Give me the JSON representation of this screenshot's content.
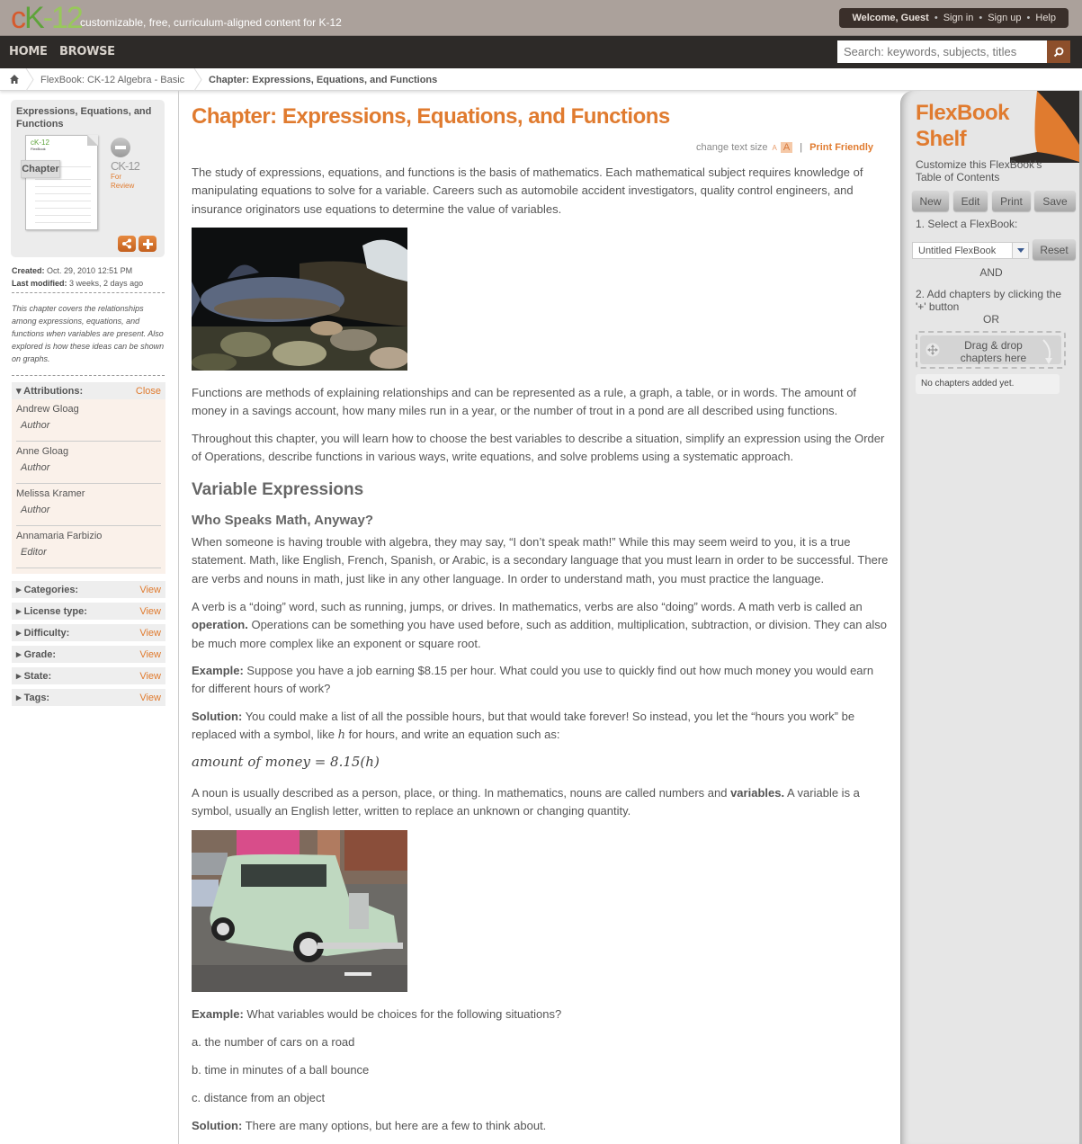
{
  "header": {
    "logo": {
      "c": "c",
      "k": "K",
      "num": "-12"
    },
    "tagline": "customizable, free, curriculum-aligned content for K-12",
    "welcome": "Welcome, Guest",
    "sign_in": "Sign in",
    "sign_up": "Sign up",
    "help": "Help",
    "separator": "•"
  },
  "nav": {
    "items": [
      {
        "label": "HOME"
      },
      {
        "label": "BROWSE"
      }
    ],
    "search_placeholder": "Search: keywords, subjects, titles"
  },
  "breadcrumb": {
    "items": [
      {
        "label": "FlexBook: CK-12 Algebra - Basic"
      },
      {
        "label": "Chapter: Expressions, Equations, and Functions"
      }
    ]
  },
  "sidebar": {
    "card": {
      "title": "Expressions, Equations, and Functions",
      "doc_logo": "cK-12",
      "doc_logo_sub": "FlexBook",
      "doc_tab": "Chapter",
      "publisher": "CK-12",
      "status_line1": "For",
      "status_line2": "Review"
    },
    "created_label": "Created:",
    "created_value": "Oct. 29, 2010 12:51 PM",
    "modified_label": "Last modified:",
    "modified_value": "3 weeks, 2 days ago",
    "description": "This chapter covers the relationships among expressions, equations, and functions when variables are present. Also explored is how these ideas can be shown on graphs.",
    "attributions": {
      "label": "▾ Attributions:",
      "action": "Close",
      "people": [
        {
          "name": "Andrew Gloag",
          "role": "Author"
        },
        {
          "name": "Anne Gloag",
          "role": "Author"
        },
        {
          "name": "Melissa Kramer",
          "role": "Author"
        },
        {
          "name": "Annamaria Farbizio",
          "role": "Editor"
        }
      ]
    },
    "properties": [
      {
        "label": "▸ Categories:",
        "action": "View"
      },
      {
        "label": "▸ License type:",
        "action": "View"
      },
      {
        "label": "▸ Difficulty:",
        "action": "View"
      },
      {
        "label": "▸ Grade:",
        "action": "View"
      },
      {
        "label": "▸ State:",
        "action": "View"
      },
      {
        "label": "▸ Tags:",
        "action": "View"
      }
    ]
  },
  "main": {
    "title": "Chapter: Expressions, Equations, and Functions",
    "change_text_size": "change text size",
    "size_small": "A",
    "size_large": "A",
    "divider": "|",
    "print_friendly": "Print Friendly",
    "intro": "The study of expressions, equations, and functions is the basis of mathematics. Each mathematical subject requires knowledge of manipulating equations to solve for a variable. Careers such as automobile accident investigators, quality control engineers, and insurance originators use equations to determine the value of variables.",
    "image1_alt": "Trout swimming over rocks",
    "functions_para": "Functions are methods of explaining relationships and can be represented as a rule, a graph, a table, or in words. The amount of money in a savings account, how many miles run in a year, or the number of trout in a pond are all described using functions.",
    "throughout_para": "Throughout this chapter, you will learn how to choose the best variables to describe a situation, simplify an expression using the Order of Operations, describe functions in various ways, write equations, and solve problems using a systematic approach.",
    "h2": "Variable Expressions",
    "h3": "Who Speaks Math, Anyway?",
    "speak_para": "When someone is having trouble with algebra, they may say, “I don’t speak math!” While this may seem weird to you, it is a true statement. Math, like English, French, Spanish, or Arabic, is a secondary language that you must learn in order to be successful. There are verbs and nouns in math, just like in any other language. In order to understand math, you must practice the language.",
    "verb_para_a": "A verb is a “doing” word, such as running, jumps, or drives. In mathematics, verbs are also “doing” words. A math verb is called an ",
    "verb_para_bold": "operation.",
    "verb_para_b": " Operations can be something you have used before, such as addition, multiplication, subtraction, or division. They can also be much more complex like an exponent or square root.",
    "example1_label": "Example:",
    "example1_text": " Suppose you have a job earning $8.15 per hour. What could you use to quickly find out how much money you would earn for different hours of work?",
    "solution1_label": "Solution:",
    "solution1_text_a": " You could make a list of all the possible hours, but that would take forever! So instead, you let the “hours you work” be replaced with a symbol, like ",
    "solution1_var": "h",
    "solution1_text_b": " for hours, and write an equation such as:",
    "equation": "amount of money = 8.15(h)",
    "noun_para_a": "A noun is usually described as a person, place, or thing. In mathematics, nouns are called numbers and ",
    "noun_para_bold": "variables.",
    "noun_para_b": " A variable is a symbol, usually an English letter, written to replace an unknown or changing quantity.",
    "image2_alt": "Vintage green car on a street",
    "example2_label": "Example:",
    "example2_text": " What variables would be choices for the following situations?",
    "items": [
      "a. the number of cars on a road",
      "b. time in minutes of a ball bounce",
      "c. distance from an object"
    ],
    "solution2_label": "Solution:",
    "solution2_text": " There are many options, but here are a few to think about."
  },
  "shelf": {
    "title_line1": "FlexBook",
    "title_line2": "Shelf",
    "subtitle": "Customize this FlexBook's Table of Contents",
    "buttons": [
      {
        "label": "New"
      },
      {
        "label": "Edit"
      },
      {
        "label": "Print"
      },
      {
        "label": "Save"
      }
    ],
    "step1": "1. Select a FlexBook:",
    "select_value": "Untitled FlexBook",
    "reset": "Reset",
    "and": "AND",
    "step2": "2. Add chapters by clicking the '+' button",
    "or": "OR",
    "drop_text": "Drag & drop chapters here",
    "empty": "No chapters added yet."
  },
  "colors": {
    "accent": "#e07b2f",
    "topbar": "#aba19b",
    "navbar": "#2d2a28",
    "search_button": "#8d4f2b"
  }
}
